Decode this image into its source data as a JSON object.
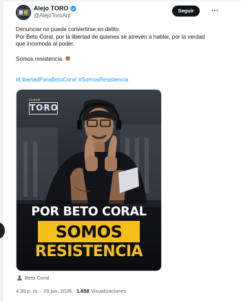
{
  "author": {
    "display_name": "Alejo TORO",
    "handle": "@AlejoToroAnt"
  },
  "follow_label": "Seguir",
  "tweet": {
    "line1": "Denunciar no puede convertirse en delito.",
    "line2": "Por Beto Coral, por la libertad de quienes se atreven a hablar, por la verdad que incomoda al poder.",
    "line3": "Somos resistencia.",
    "hashtags": [
      "#LibertadParaBetoCoral",
      "#SomosResistencia"
    ]
  },
  "media": {
    "brand_small": "ALEJO",
    "brand_big": "TORO",
    "headline": "POR BETO CORAL",
    "banner_line1": "SOMOS",
    "banner_line2": "RESISTENCIA"
  },
  "tagged_user": "Beto Coral",
  "meta": {
    "time": "4:30 p. m.",
    "separator": "·",
    "date": "26 jun. 2026",
    "views_count": "1.658",
    "views_label": "Visualizaciones"
  },
  "colors": {
    "link": "#1d9bf0",
    "banner_yellow": "#f5c118",
    "follow_bg": "#0f1419"
  },
  "icons": [
    "verified-badge-icon",
    "more-options-icon",
    "fist-emoji-icon",
    "person-tag-icon"
  ]
}
